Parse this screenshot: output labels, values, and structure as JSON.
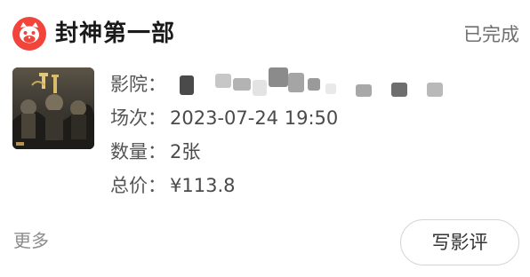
{
  "header": {
    "app_icon": "cat-logo-icon",
    "movie_title": "封神第一部",
    "status": "已完成"
  },
  "order": {
    "cinema_label": "影院：",
    "cinema_value_redacted": true,
    "session_label": "场次：",
    "session_value": "2023-07-24 19:50",
    "quantity_label": "数量：",
    "quantity_value": "2张",
    "price_label": "总价：",
    "price_value": "¥113.8"
  },
  "footer": {
    "more_label": "更多",
    "review_button_label": "写影评"
  },
  "colors": {
    "brand_red": "#f1453c",
    "status_gray": "#6f6f6f"
  }
}
